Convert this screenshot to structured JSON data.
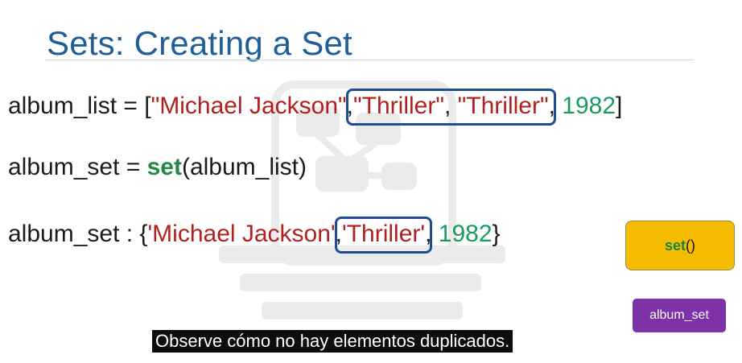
{
  "slide": {
    "title": "Sets: Creating a Set",
    "line1": {
      "prefix": "album_list = [",
      "string1": "\"Michael Jackson\"",
      "comma1": ",",
      "highlight": {
        "string2": "\"Thriller\"",
        "comma2": ", ",
        "string3": "\"Thriller\""
      },
      "comma3": ",",
      "number": " 1982",
      "suffix": "]"
    },
    "line2": {
      "prefix": "album_set = ",
      "keyword": "set",
      "suffix": "(album_list)"
    },
    "line3": {
      "prefix": "album_set :  {",
      "string1": "'Michael Jackson'",
      "comma1": ",",
      "highlight": {
        "string2": " 'Thriller'"
      },
      "comma2": ",",
      "number": " 1982",
      "suffix": "}"
    }
  },
  "buttons": {
    "set_fn": "set",
    "set_parens": "()",
    "album_set": "album_set"
  },
  "subtitle": {
    "text": "Observe cómo no hay elementos duplicados."
  },
  "colors": {
    "title": "#1f5e96",
    "string": "#b11f1f",
    "number": "#1d9a61",
    "keyword": "#1f8a45",
    "highlight_border": "#1f4d8f",
    "set_button": "#f6bd00",
    "album_button": "#7d32a8",
    "caption_bg": "#0d0d0d"
  }
}
